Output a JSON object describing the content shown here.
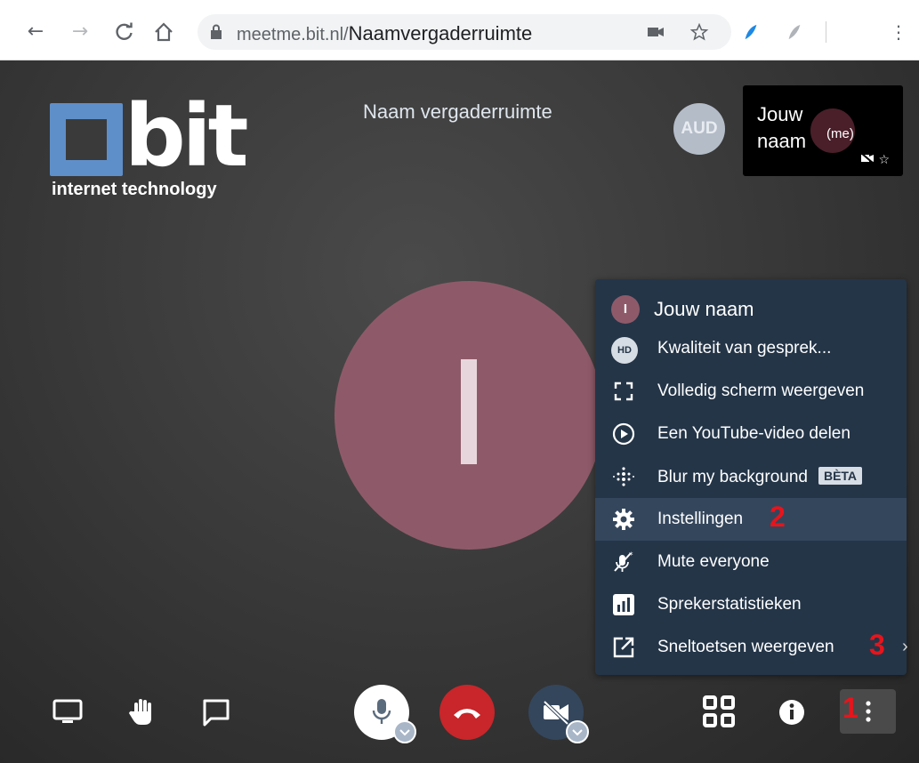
{
  "browser": {
    "url_host": "meetme.bit.nl/",
    "url_path": "Naamvergaderruimte"
  },
  "logo": {
    "word": "bit",
    "tagline": "internet technology"
  },
  "room": {
    "title": "Naam vergaderruimte"
  },
  "participants": {
    "aud_initials": "AUD",
    "thumb_name": "Jouw naam",
    "thumb_me": "(me)"
  },
  "main_avatar": {
    "initial": "I",
    "color": "#8e5a69"
  },
  "menu": {
    "profile_initial": "I",
    "profile_name": "Jouw naam",
    "hd_badge": "HD",
    "beta_badge": "BÈTA",
    "items": [
      {
        "label": "Kwaliteit van gesprek...",
        "icon": "hd-icon"
      },
      {
        "label": "Volledig scherm weergeven",
        "icon": "fullscreen-icon"
      },
      {
        "label": "Een YouTube-video delen",
        "icon": "play-icon"
      },
      {
        "label": "Blur my background",
        "icon": "blur-icon"
      },
      {
        "label": "Instellingen",
        "icon": "gear-icon"
      },
      {
        "label": "Mute everyone",
        "icon": "mic-mute-icon"
      },
      {
        "label": "Sprekerstatistieken",
        "icon": "stats-icon"
      },
      {
        "label": "Sneltoetsen weergeven",
        "icon": "shortcut-icon"
      }
    ]
  },
  "markers": {
    "m1": "1",
    "m2": "2",
    "m3": "3"
  },
  "colors": {
    "accent_red": "#e8141b",
    "menu_bg": "#243548",
    "hangup": "#c8262a"
  }
}
